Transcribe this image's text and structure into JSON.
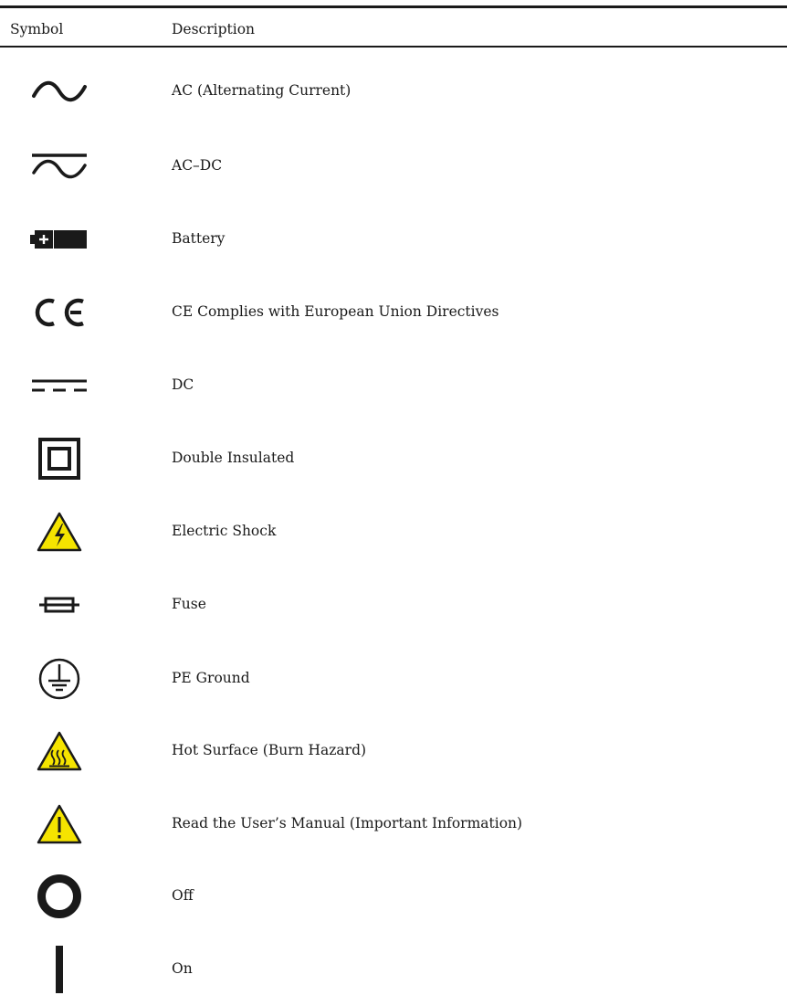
{
  "table": {
    "header": {
      "symbol": "Symbol",
      "description": "Description"
    },
    "rows": [
      {
        "icon": "ac-sine-icon",
        "description": "AC (Alternating Current)"
      },
      {
        "icon": "ac-dc-icon",
        "description": "AC–DC"
      },
      {
        "icon": "battery-icon",
        "description": "Battery"
      },
      {
        "icon": "ce-mark-icon",
        "description": "CE Complies with European Union Directives"
      },
      {
        "icon": "dc-icon",
        "description": "DC"
      },
      {
        "icon": "double-insulated-icon",
        "description": "Double Insulated"
      },
      {
        "icon": "electric-shock-warning-icon",
        "description": "Electric Shock"
      },
      {
        "icon": "fuse-icon",
        "description": "Fuse"
      },
      {
        "icon": "pe-ground-icon",
        "description": "PE Ground"
      },
      {
        "icon": "hot-surface-warning-icon",
        "description": "Hot Surface (Burn Hazard)"
      },
      {
        "icon": "caution-warning-icon",
        "description": "Read the User’s Manual (Important Information)"
      },
      {
        "icon": "off-circle-icon",
        "description": "Off"
      },
      {
        "icon": "on-bar-icon",
        "description": "On"
      }
    ]
  },
  "colors": {
    "text": "#1a1a1a",
    "warning_yellow": "#f5e400",
    "rule": "#1a1a1a"
  }
}
